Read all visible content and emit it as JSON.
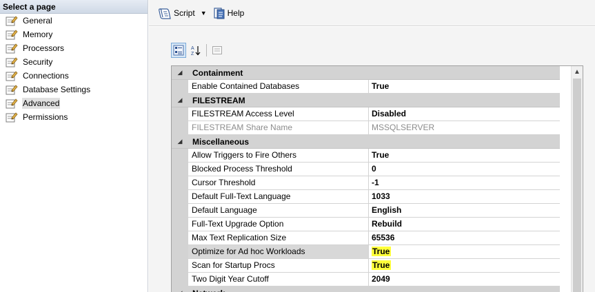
{
  "left_panel": {
    "header": "Select a page",
    "pages": [
      {
        "label": "General",
        "selected": false
      },
      {
        "label": "Memory",
        "selected": false
      },
      {
        "label": "Processors",
        "selected": false
      },
      {
        "label": "Security",
        "selected": false
      },
      {
        "label": "Connections",
        "selected": false
      },
      {
        "label": "Database Settings",
        "selected": false
      },
      {
        "label": "Advanced",
        "selected": true
      },
      {
        "label": "Permissions",
        "selected": false
      }
    ]
  },
  "toolbar": {
    "script_label": "Script",
    "help_label": "Help"
  },
  "grid_toolbar": {
    "buttons": [
      "categorized-icon",
      "alphabetical-icon",
      "property-pages-icon"
    ]
  },
  "property_grid": {
    "categories": [
      {
        "name": "Containment",
        "expanded": true,
        "properties": [
          {
            "name": "Enable Contained Databases",
            "value": "True"
          }
        ]
      },
      {
        "name": "FILESTREAM",
        "expanded": true,
        "properties": [
          {
            "name": "FILESTREAM Access Level",
            "value": "Disabled"
          },
          {
            "name": "FILESTREAM Share Name",
            "value": "MSSQLSERVER",
            "disabled": true
          }
        ]
      },
      {
        "name": "Miscellaneous",
        "expanded": true,
        "properties": [
          {
            "name": "Allow Triggers to Fire Others",
            "value": "True"
          },
          {
            "name": "Blocked Process Threshold",
            "value": "0"
          },
          {
            "name": "Cursor Threshold",
            "value": "-1"
          },
          {
            "name": "Default Full-Text Language",
            "value": "1033"
          },
          {
            "name": "Default Language",
            "value": "English"
          },
          {
            "name": "Full-Text Upgrade Option",
            "value": "Rebuild"
          },
          {
            "name": "Max Text Replication Size",
            "value": "65536"
          },
          {
            "name": "Optimize for Ad hoc Workloads",
            "value": "True",
            "selected": true,
            "highlighted": true
          },
          {
            "name": "Scan for Startup Procs",
            "value": "True",
            "highlighted": true
          },
          {
            "name": "Two Digit Year Cutoff",
            "value": "2049"
          }
        ]
      },
      {
        "name": "Network",
        "expanded": true,
        "properties": []
      }
    ]
  },
  "colors": {
    "highlight": "#ffff3a",
    "category_band": "#d3d3d3",
    "selected_row": "#d8d8d8"
  }
}
